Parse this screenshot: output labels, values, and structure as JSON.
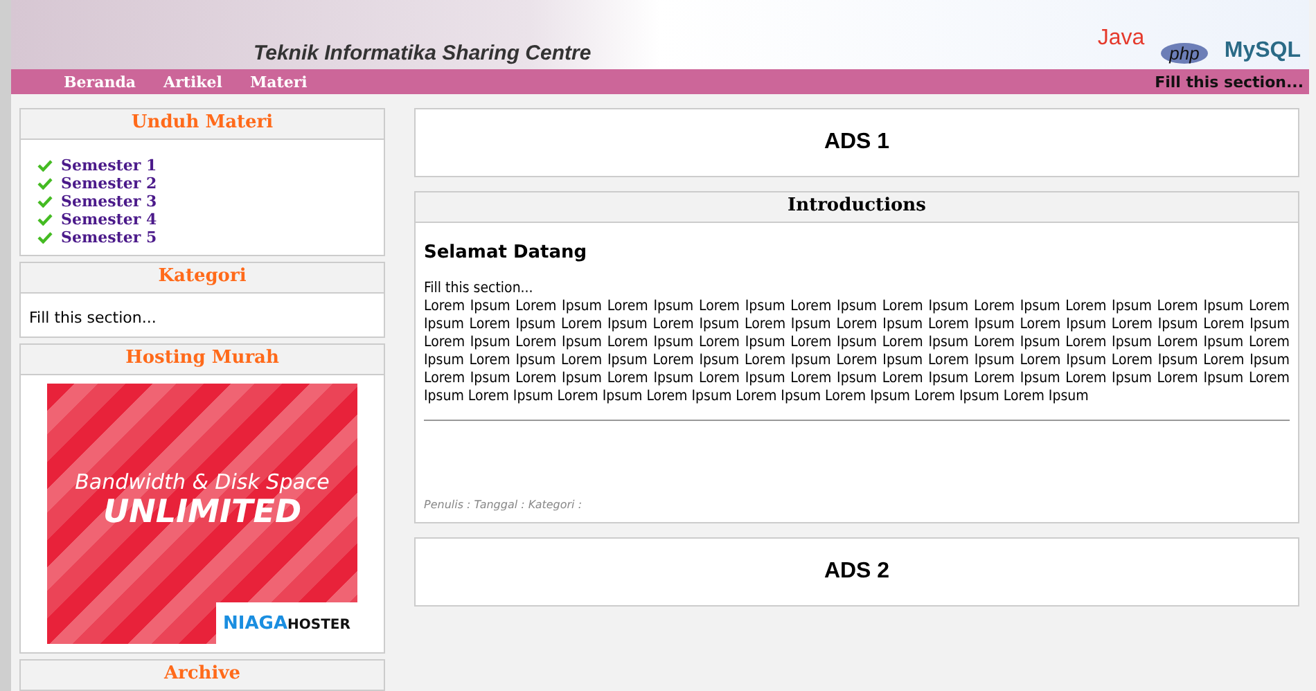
{
  "header": {
    "tagline": "Teknik Informatika Sharing Centre",
    "logos": [
      "Java",
      "php",
      "MySQL"
    ]
  },
  "nav": {
    "items": [
      {
        "label": "Beranda"
      },
      {
        "label": "Artikel"
      },
      {
        "label": "Materi"
      }
    ],
    "right_text": "Fill this section..."
  },
  "sidebar": [
    {
      "kind": "links",
      "title": "Unduh Materi",
      "items": [
        "Semester 1",
        "Semester 2",
        "Semester 3",
        "Semester 4",
        "Semester 5"
      ]
    },
    {
      "kind": "text",
      "title": "Kategori",
      "text": "Fill this section..."
    },
    {
      "kind": "ad",
      "title": "Hosting Murah",
      "ad": {
        "line1": "Bandwidth & Disk Space",
        "line2": "UNLIMITED",
        "brand_a": "NIAGA",
        "brand_b": "HOSTER"
      }
    },
    {
      "kind": "empty",
      "title": "Archive"
    }
  ],
  "main": [
    {
      "kind": "ads",
      "text": "ADS 1"
    },
    {
      "kind": "post",
      "title": "Introductions",
      "heading": "Selamat Datang",
      "intro": "Fill this section...",
      "body": "Lorem Ipsum Lorem Ipsum Lorem Ipsum Lorem Ipsum Lorem Ipsum Lorem Ipsum Lorem Ipsum Lorem Ipsum Lorem Ipsum Lorem Ipsum Lorem Ipsum Lorem Ipsum Lorem Ipsum Lorem Ipsum Lorem Ipsum Lorem Ipsum Lorem Ipsum Lorem Ipsum Lorem Ipsum Lorem Ipsum Lorem Ipsum Lorem Ipsum Lorem Ipsum Lorem Ipsum Lorem Ipsum Lorem Ipsum Lorem Ipsum Lorem Ipsum Lorem Ipsum Lorem Ipsum Lorem Ipsum Lorem Ipsum Lorem Ipsum Lorem Ipsum Lorem Ipsum Lorem Ipsum Lorem Ipsum Lorem Ipsum Lorem Ipsum Lorem Ipsum Lorem Ipsum Lorem Ipsum Lorem Ipsum Lorem Ipsum Lorem Ipsum Lorem Ipsum Lorem Ipsum Lorem Ipsum Lorem Ipsum Lorem Ipsum Lorem Ipsum Lorem Ipsum Lorem Ipsum Lorem Ipsum Lorem Ipsum",
      "meta": "Penulis : Tanggal : Kategori :"
    },
    {
      "kind": "ads",
      "text": "ADS 2"
    }
  ]
}
